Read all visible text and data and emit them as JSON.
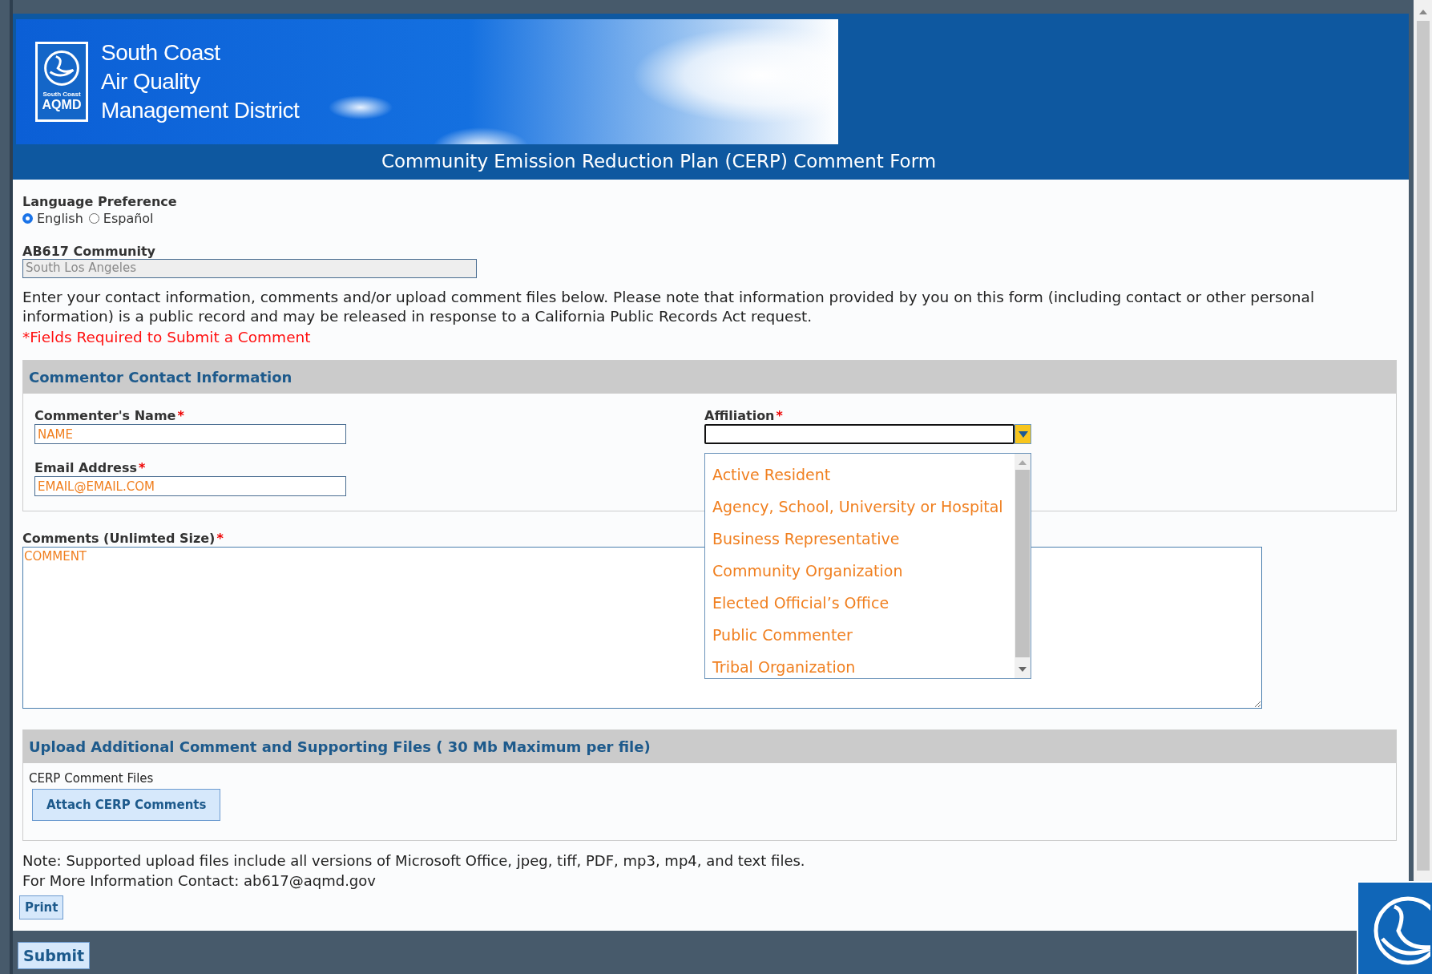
{
  "header": {
    "logo_text": [
      "South Coast",
      "AQMD"
    ],
    "org_name": [
      "South Coast",
      "Air Quality",
      "Management District"
    ],
    "form_title": "Community Emission Reduction Plan (CERP) Comment Form"
  },
  "language": {
    "label": "Language Preference",
    "options": [
      {
        "label": "English",
        "selected": true
      },
      {
        "label": "Español",
        "selected": false
      }
    ]
  },
  "community": {
    "label": "AB617 Community",
    "value": "South Los Angeles",
    "disabled": true
  },
  "intro": "Enter your contact information, comments and/or upload comment files below. Please note that information provided by you on this form (including contact or other personal information) is a public record and may be released in response to a California Public Records Act request.",
  "required_note": "*Fields Required to Submit a Comment",
  "contact_section": {
    "title": "Commentor Contact Information",
    "name": {
      "label": "Commenter's Name",
      "required_mark": "*",
      "placeholder": "NAME"
    },
    "email": {
      "label": "Email Address",
      "required_mark": "*",
      "placeholder": "EMAIL@EMAIL.COM"
    },
    "affiliation": {
      "label": "Affiliation",
      "required_mark": "*",
      "expanded": true,
      "options": [
        "Active Resident",
        "Agency, School, University or Hospital",
        "Business Representative",
        "Community Organization",
        "Elected Official’s Office",
        "Public Commenter",
        "Tribal Organization"
      ]
    }
  },
  "comments": {
    "label": "Comments (Unlimted Size)",
    "required_mark": "*",
    "placeholder": "COMMENT"
  },
  "upload_section": {
    "title": "Upload Additional Comment and Supporting Files ( 30 Mb Maximum per file)",
    "files_label": "CERP Comment Files",
    "attach_button": "Attach CERP Comments"
  },
  "note": "Note: Supported upload files include all versions of Microsoft Office, jpeg, tiff, PDF, mp3, mp4, and text files.",
  "contact_line": "For More Information Contact: ab617@aqmd.gov",
  "print_button": "Print",
  "submit_button": "Submit"
}
